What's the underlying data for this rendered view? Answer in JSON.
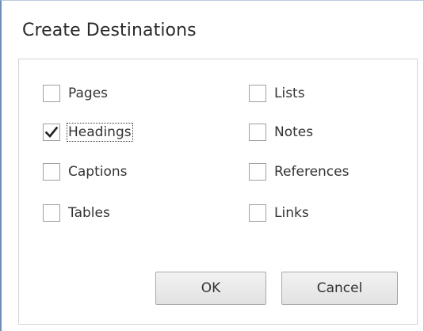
{
  "dialog": {
    "title": "Create Destinations"
  },
  "options": {
    "pages": {
      "label": "Pages",
      "checked": false
    },
    "headings": {
      "label": "Headings",
      "checked": true
    },
    "captions": {
      "label": "Captions",
      "checked": false
    },
    "tables": {
      "label": "Tables",
      "checked": false
    },
    "lists": {
      "label": "Lists",
      "checked": false
    },
    "notes": {
      "label": "Notes",
      "checked": false
    },
    "references": {
      "label": "References",
      "checked": false
    },
    "links": {
      "label": "Links",
      "checked": false
    }
  },
  "buttons": {
    "ok": "OK",
    "cancel": "Cancel"
  },
  "icons": {
    "checkmark": "checkmark-icon"
  },
  "colors": {
    "window_border": "#6f8fb6",
    "checkmark": "#222222"
  }
}
